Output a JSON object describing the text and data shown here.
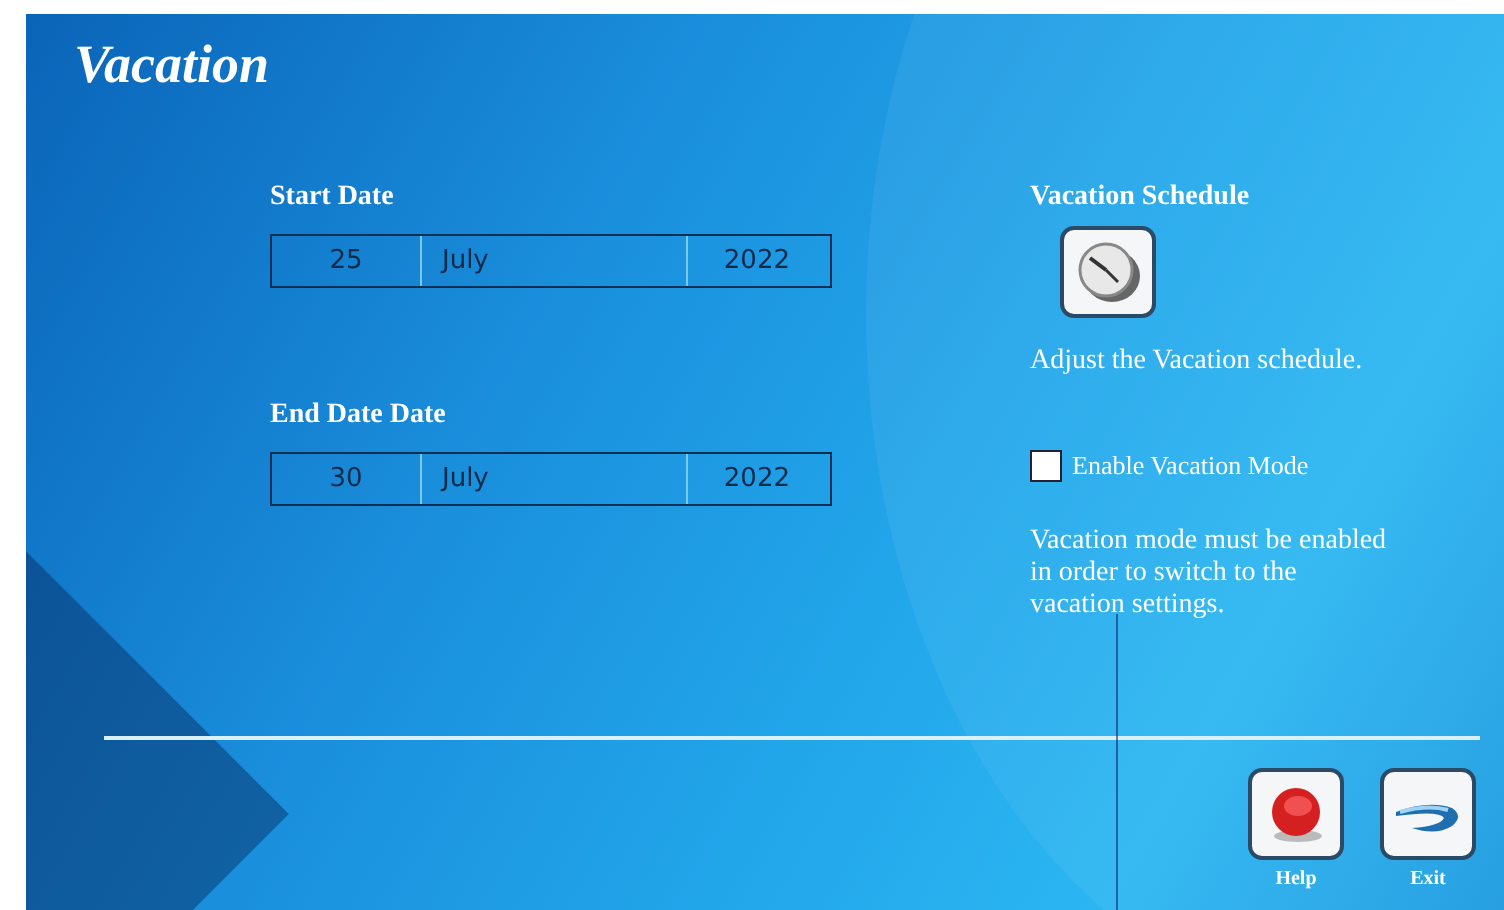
{
  "title": "Vacation",
  "start_date": {
    "label": "Start Date",
    "day": "25",
    "month": "July",
    "year": "2022"
  },
  "end_date": {
    "label": "End Date Date",
    "day": "30",
    "month": "July",
    "year": "2022"
  },
  "schedule": {
    "heading": "Vacation Schedule",
    "description": "Adjust the Vacation schedule."
  },
  "vacation_mode": {
    "label": "Enable Vacation Mode",
    "checked": false
  },
  "note": "Vacation mode must be enabled in order to switch to the vacation settings.",
  "buttons": [
    {
      "kind": "help",
      "label": "Help"
    },
    {
      "kind": "exit",
      "label": "Exit"
    }
  ]
}
